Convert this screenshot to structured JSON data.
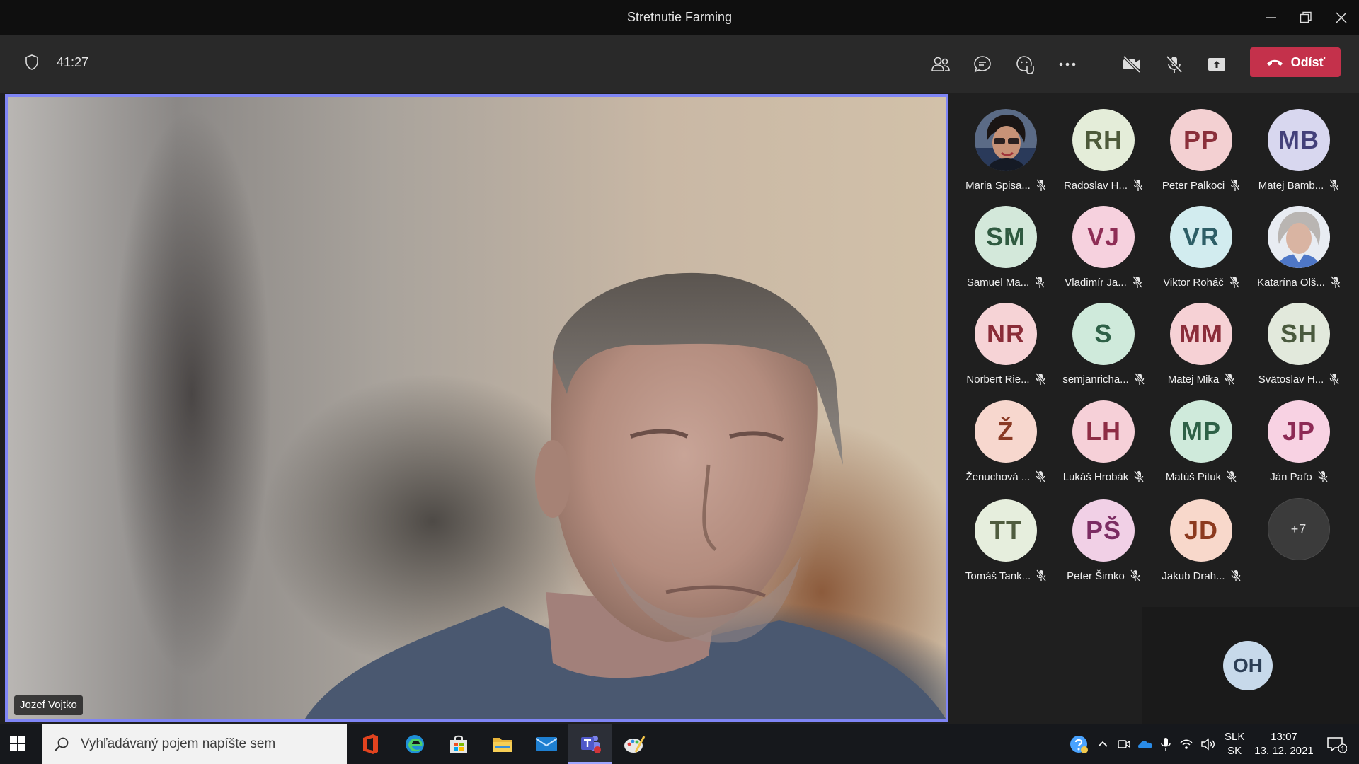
{
  "window": {
    "title": "Stretnutie Farming"
  },
  "header": {
    "timer": "41:27",
    "leave_label": "Odísť"
  },
  "video": {
    "speaker_name": "Jozef Vojtko"
  },
  "participants": [
    {
      "initials": "",
      "name": "Maria Spisa...",
      "photo": "photo-woman-glasses",
      "bg": "#3a3a3a",
      "fg": "#fff"
    },
    {
      "initials": "RH",
      "name": "Radoslav H...",
      "bg": "#e4edd9",
      "fg": "#4d5a3a"
    },
    {
      "initials": "PP",
      "name": "Peter Palkoci",
      "bg": "#f3d0d2",
      "fg": "#8a2f3a"
    },
    {
      "initials": "MB",
      "name": "Matej Bamb...",
      "bg": "#d8d7ef",
      "fg": "#43407a"
    },
    {
      "initials": "SM",
      "name": "Samuel Ma...",
      "bg": "#d3e8da",
      "fg": "#2f5a40"
    },
    {
      "initials": "VJ",
      "name": "Vladimír Ja...",
      "bg": "#f6d1de",
      "fg": "#8e2d55"
    },
    {
      "initials": "VR",
      "name": "Viktor Roháč",
      "bg": "#d2ecef",
      "fg": "#2d5e66"
    },
    {
      "initials": "",
      "name": "Katarína Olš...",
      "photo": "photo-woman-grey",
      "bg": "#cfd7e3",
      "fg": "#fff"
    },
    {
      "initials": "NR",
      "name": "Norbert Rie...",
      "bg": "#f6d3d6",
      "fg": "#8a2c38"
    },
    {
      "initials": "S",
      "name": "semjanricha...",
      "bg": "#cfeadb",
      "fg": "#2e6147"
    },
    {
      "initials": "MM",
      "name": "Matej Mika",
      "bg": "#f6d1d5",
      "fg": "#8b2d3a"
    },
    {
      "initials": "SH",
      "name": "Svätoslav H...",
      "bg": "#e2e9dc",
      "fg": "#4a5a3e"
    },
    {
      "initials": "Ž",
      "name": "Ženuchová ...",
      "bg": "#f7d7ce",
      "fg": "#8a3a25"
    },
    {
      "initials": "LH",
      "name": "Lukáš Hrobák",
      "bg": "#f6d0d8",
      "fg": "#8e2d45"
    },
    {
      "initials": "MP",
      "name": "Matúš Pituk",
      "bg": "#cfeadb",
      "fg": "#2e6147"
    },
    {
      "initials": "JP",
      "name": "Ján Paľo",
      "bg": "#f8d2e3",
      "fg": "#8d2a55"
    },
    {
      "initials": "TT",
      "name": "Tomáš Tank...",
      "bg": "#e6eedd",
      "fg": "#4f5c3e"
    },
    {
      "initials": "PŠ",
      "name": "Peter Šimko",
      "bg": "#f1d0e6",
      "fg": "#7b2c62"
    },
    {
      "initials": "JD",
      "name": "Jakub Drah...",
      "bg": "#f8d8cb",
      "fg": "#8c3a1f"
    }
  ],
  "overflow": {
    "label": "+7"
  },
  "self": {
    "initials": "OH"
  },
  "taskbar": {
    "search_placeholder": "Vyhľadávaný pojem napíšte sem",
    "lang_top": "SLK",
    "lang_bottom": "SK",
    "time": "13:07",
    "date": "13. 12. 2021",
    "notification_count": "1"
  },
  "colors": {
    "accent": "#7f85f5",
    "leave": "#c4314b"
  }
}
